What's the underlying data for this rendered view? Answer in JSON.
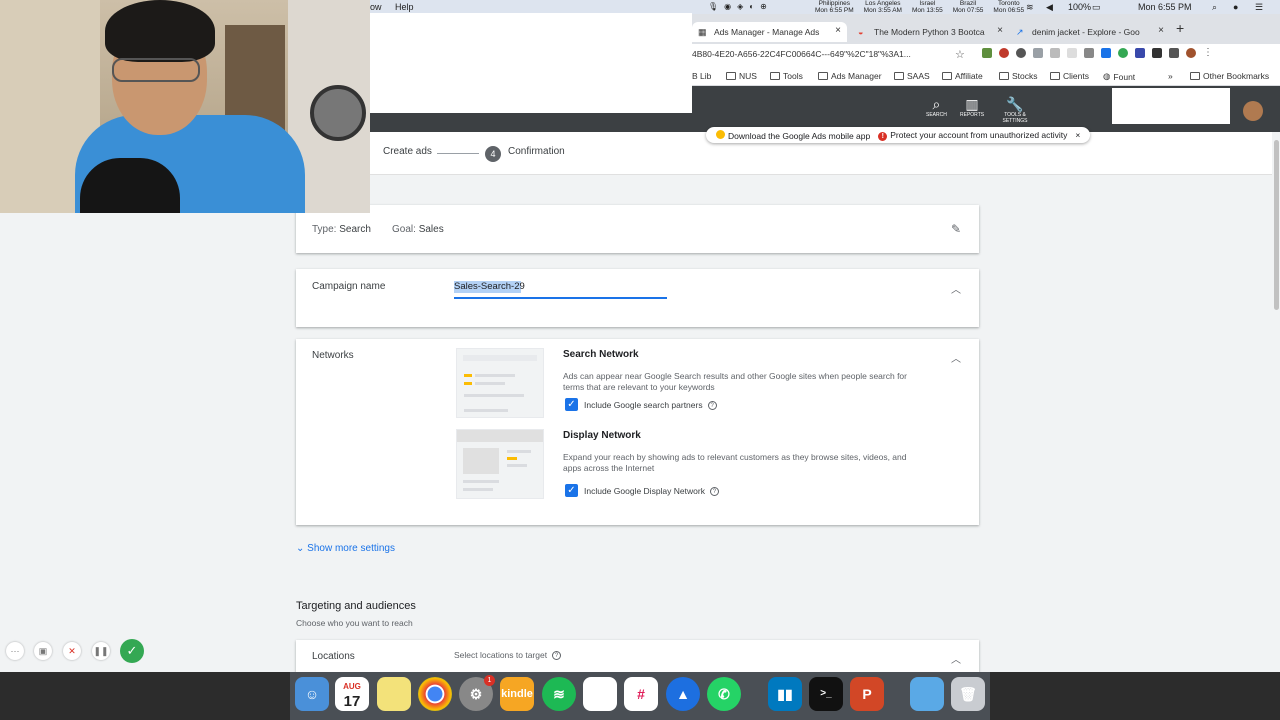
{
  "menubar": {
    "items": [
      "ow",
      "Help"
    ],
    "clocks": [
      {
        "city": "Philippines",
        "time": "Mon 6:55 PM"
      },
      {
        "city": "Los Angeles",
        "time": "Mon 3:55 AM"
      },
      {
        "city": "Israel",
        "time": "Mon 13:55"
      },
      {
        "city": "Brazil",
        "time": "Mon 07:55"
      },
      {
        "city": "Toronto",
        "time": "Mon 06:55"
      }
    ],
    "battery": "100%",
    "clock": "Mon 6:55 PM"
  },
  "tabs": [
    {
      "label": "Ads Manager - Manage Ads",
      "close": "×"
    },
    {
      "label": "The Modern Python 3 Bootca",
      "close": "×"
    },
    {
      "label": "denim jacket - Explore - Goo",
      "close": "×"
    }
  ],
  "new_tab": "+",
  "address": {
    "url": "4B80-4E20-A656-22C4FC00664C---649\"%2C\"18\"%3A1..."
  },
  "bookmarks": [
    "B Lib",
    "NUS",
    "Tools",
    "Ads Manager",
    "SAAS",
    "Affiliate",
    "Stocks",
    "Clients",
    "Fount",
    "»",
    "Other Bookmarks"
  ],
  "ads_header": {
    "search": "SEARCH",
    "reports": "REPORTS",
    "tools": "TOOLS & SETTINGS",
    "help": "?",
    "badge": "!"
  },
  "notification": {
    "app_msg": "Download the Google Ads mobile app",
    "security_msg": "Protect your account from unauthorized activity",
    "close": "×"
  },
  "stepper": {
    "step3": "Create ads",
    "step4_num": "4",
    "step4": "Confirmation"
  },
  "summary": {
    "type_label": "Type:",
    "type_value": "Search",
    "goal_label": "Goal:",
    "goal_value": "Sales"
  },
  "campaign_name": {
    "label": "Campaign name",
    "value": "Sales-Search-29"
  },
  "networks": {
    "label": "Networks",
    "search": {
      "title": "Search Network",
      "desc": "Ads can appear near Google Search results and other Google sites when people search for terms that are relevant to your keywords",
      "checkbox": "Include Google search partners",
      "checked": true
    },
    "display": {
      "title": "Display Network",
      "desc": "Expand your reach by showing ads to relevant customers as they browse sites, videos, and apps across the Internet",
      "checkbox": "Include Google Display Network",
      "checked": true
    }
  },
  "more_settings": "Show more settings",
  "targeting": {
    "title": "Targeting and audiences",
    "subtitle": "Choose who you want to reach"
  },
  "locations": {
    "label": "Locations",
    "hint": "Select locations to target"
  },
  "dock": {
    "calendar_month": "AUG",
    "calendar_day": "17",
    "kindle": "kindle",
    "settings_badge": "1"
  }
}
